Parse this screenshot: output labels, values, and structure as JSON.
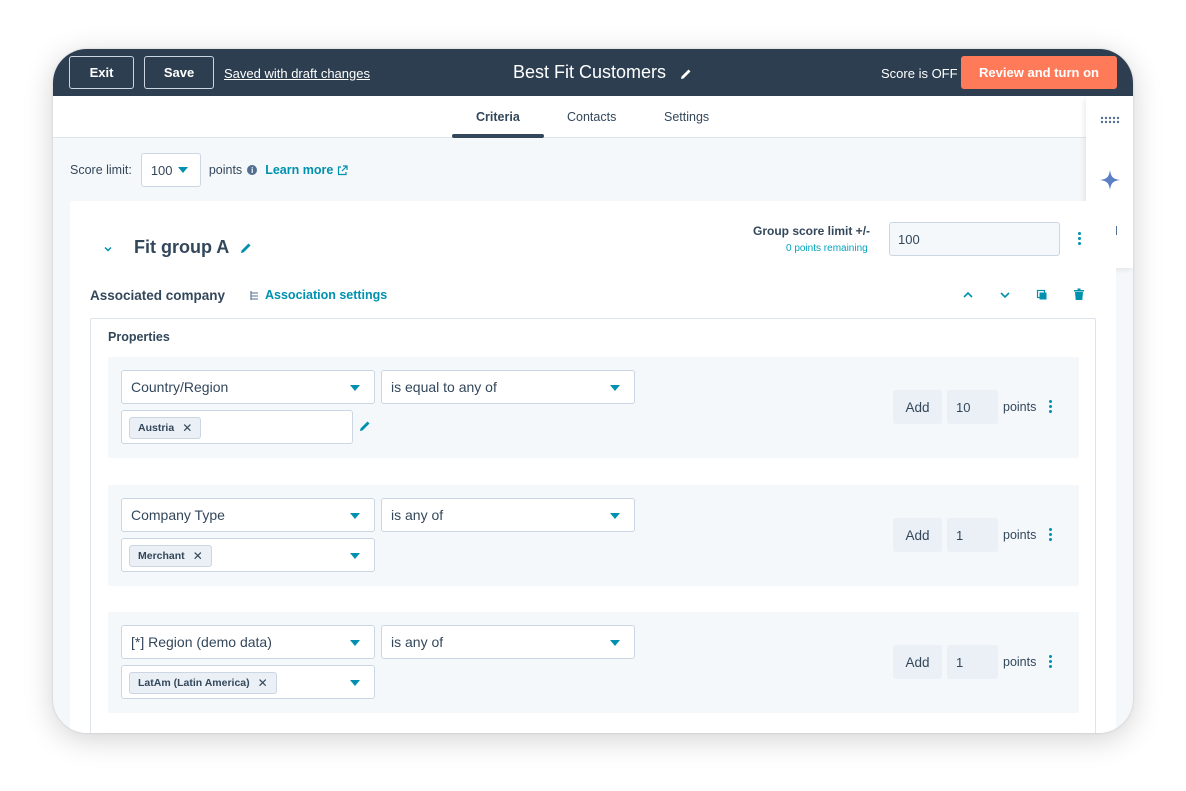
{
  "topbar": {
    "exit_label": "Exit",
    "save_label": "Save",
    "saved_status": "Saved with draft changes",
    "title": "Best Fit Customers",
    "score_status": "Score is OFF",
    "review_label": "Review and turn on"
  },
  "tabs": [
    {
      "label": "Criteria",
      "active": true
    },
    {
      "label": "Contacts",
      "active": false
    },
    {
      "label": "Settings",
      "active": false
    }
  ],
  "side_rail": {
    "icons": [
      "grid-dots-icon",
      "sparkle-icon",
      "chat-icon"
    ]
  },
  "score_limit": {
    "label": "Score limit:",
    "value": "100",
    "unit": "points",
    "learn_more": "Learn more"
  },
  "group": {
    "title": "Fit group A",
    "score_limit_label": "Group score limit +/-",
    "remaining": "0 points remaining",
    "score_limit_value": "100"
  },
  "association": {
    "title": "Associated company",
    "settings_label": "Association settings"
  },
  "properties": {
    "title": "Properties",
    "rules": [
      {
        "property": "Country/Region",
        "operator": "is equal to any of",
        "value_chip": "Austria",
        "add_label": "Add",
        "points": "10",
        "points_label": "points"
      },
      {
        "property": "Company Type",
        "operator": "is any of",
        "value_chip": "Merchant",
        "add_label": "Add",
        "points": "1",
        "points_label": "points"
      },
      {
        "property": "[*] Region (demo data)",
        "operator": "is any of",
        "value_chip": "LatAm (Latin America)",
        "add_label": "Add",
        "points": "1",
        "points_label": "points"
      }
    ]
  },
  "colors": {
    "topbar_bg": "#2d3e50",
    "accent_orange": "#ff7a59",
    "link_teal": "#0091ae",
    "text_dark": "#33475b"
  }
}
